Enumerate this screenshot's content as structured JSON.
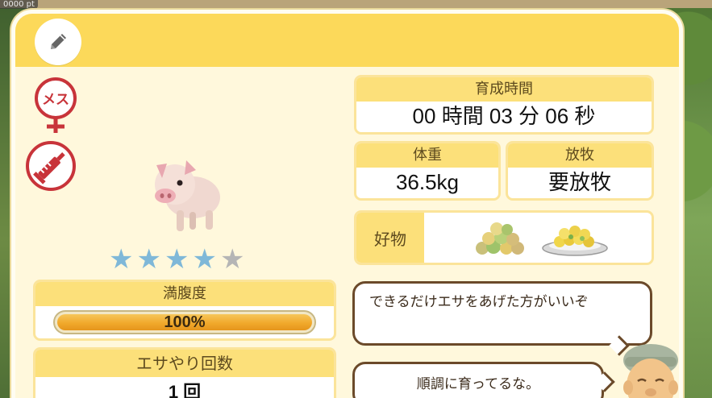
{
  "background": {
    "corner_label": "0000 pt"
  },
  "panel": {
    "edit_icon": "pencil-icon",
    "gender_icon": "female-icon",
    "gender_label": "メス",
    "vaccine_icon": "syringe-icon",
    "rating": {
      "filled": 4,
      "max": 5
    }
  },
  "stats": {
    "time": {
      "label": "育成時間",
      "value": "00 時間 03 分 06 秒"
    },
    "weight": {
      "label": "体重",
      "value": "36.5kg"
    },
    "grazing": {
      "label": "放牧",
      "value": "要放牧"
    },
    "likes": {
      "label": "好物",
      "icons": [
        "mixed-feed-icon",
        "feed-plate-icon"
      ]
    },
    "fullness": {
      "label": "満腹度",
      "value": "100%",
      "fraction": 1.0
    },
    "feedings": {
      "label": "エサやり回数",
      "value": "1 回"
    }
  },
  "dialog": {
    "bubble1": "できるだけエサをあげた方がいいぞ",
    "bubble2": "順調に育ってるな。"
  },
  "colors": {
    "header": "#fcd95a",
    "panel": "#fff8dc",
    "star_on": "#7fb8d8",
    "star_off": "#b5b5b5",
    "bar_fill": "#f1a92c",
    "bubble_border": "#6b4a2a"
  }
}
